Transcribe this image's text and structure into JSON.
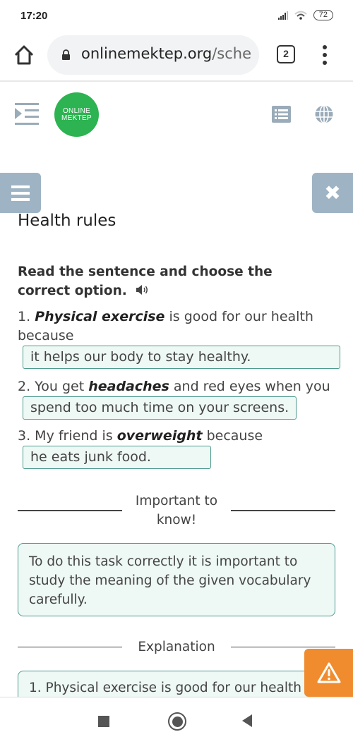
{
  "status_bar": {
    "time": "17:20",
    "battery": "72"
  },
  "browser": {
    "url_domain": "onlinemektep.org",
    "url_path": "/sche",
    "tab_count": "2"
  },
  "site_header": {
    "logo_line1": "ONLINE",
    "logo_line2": "MEKTEP",
    "logo_color": "#2db352"
  },
  "lesson": {
    "title": "Health rules",
    "instruction": "Read the sentence and choose the correct option.",
    "questions": [
      {
        "number": "1.",
        "keyword": "Physical exercise",
        "rest": " is good for our health because",
        "answer": "it helps our body to stay healthy."
      },
      {
        "number": "2.",
        "prefix": " You get ",
        "keyword": "headaches",
        "rest": " and red eyes when you",
        "answer": "spend too much time on your screens."
      },
      {
        "number": "3.",
        "prefix": " My friend is ",
        "keyword": "overweight",
        "rest": " because",
        "answer": "he eats junk food."
      }
    ],
    "important_label_line1": "Important to",
    "important_label_line2": "know!",
    "important_text": "To do this task correctly it is important to study the meaning of the given vocabulary carefully.",
    "explanation_label": "Explanation",
    "explanation_text": "1. Physical exercise is good for our health"
  },
  "colors": {
    "accent_teal": "#4e9a8e",
    "answer_bg": "#eef8f5",
    "side_button": "#9eb4c4",
    "warning": "#f08c2e"
  }
}
